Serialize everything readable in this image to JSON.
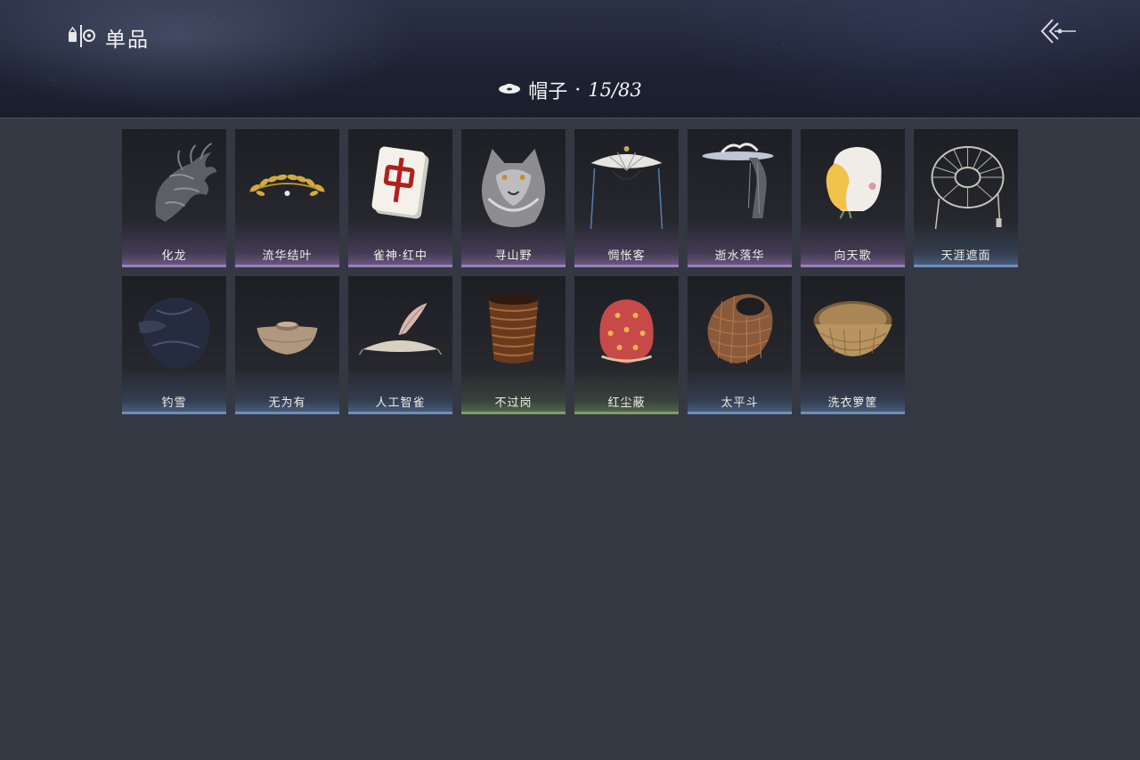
{
  "header": {
    "title": "单品",
    "category": "帽子",
    "separator": "·",
    "count": "15/83",
    "title_icon": "wardrobe-icon",
    "category_icon": "hat-icon",
    "back_icon": "back-arrow-icon"
  },
  "colors": {
    "rarity_purple": "#9a7fb8",
    "rarity_blue": "#6d8fb8",
    "rarity_green": "#7f9d6a",
    "background": "#343842"
  },
  "items": [
    {
      "name": "化龙",
      "rarity": "purple",
      "icon": "dragon-hat-icon"
    },
    {
      "name": "流华结叶",
      "rarity": "purple",
      "icon": "golden-laurel-icon"
    },
    {
      "name": "雀神·红中",
      "rarity": "purple",
      "icon": "mahjong-tile-icon"
    },
    {
      "name": "寻山野",
      "rarity": "purple",
      "icon": "wolf-hood-icon"
    },
    {
      "name": "惆怅客",
      "rarity": "purple",
      "icon": "veiled-hat-icon"
    },
    {
      "name": "逝水落华",
      "rarity": "purple",
      "icon": "ornate-hat-icon"
    },
    {
      "name": "向天歌",
      "rarity": "purple",
      "icon": "goose-hood-icon"
    },
    {
      "name": "天涯遮面",
      "rarity": "blue",
      "icon": "wicker-frame-icon"
    },
    {
      "name": "钓雪",
      "rarity": "blue",
      "icon": "dark-hood-icon"
    },
    {
      "name": "无为有",
      "rarity": "blue",
      "icon": "clay-bowl-icon"
    },
    {
      "name": "人工智雀",
      "rarity": "blue",
      "icon": "feather-hat-icon"
    },
    {
      "name": "不过岗",
      "rarity": "green",
      "icon": "stacked-bowls-icon"
    },
    {
      "name": "红尘蔽",
      "rarity": "green",
      "icon": "red-hood-icon"
    },
    {
      "name": "太平斗",
      "rarity": "blue",
      "icon": "bamboo-basket-icon"
    },
    {
      "name": "洗衣箩筐",
      "rarity": "blue",
      "icon": "laundry-basket-icon"
    }
  ]
}
